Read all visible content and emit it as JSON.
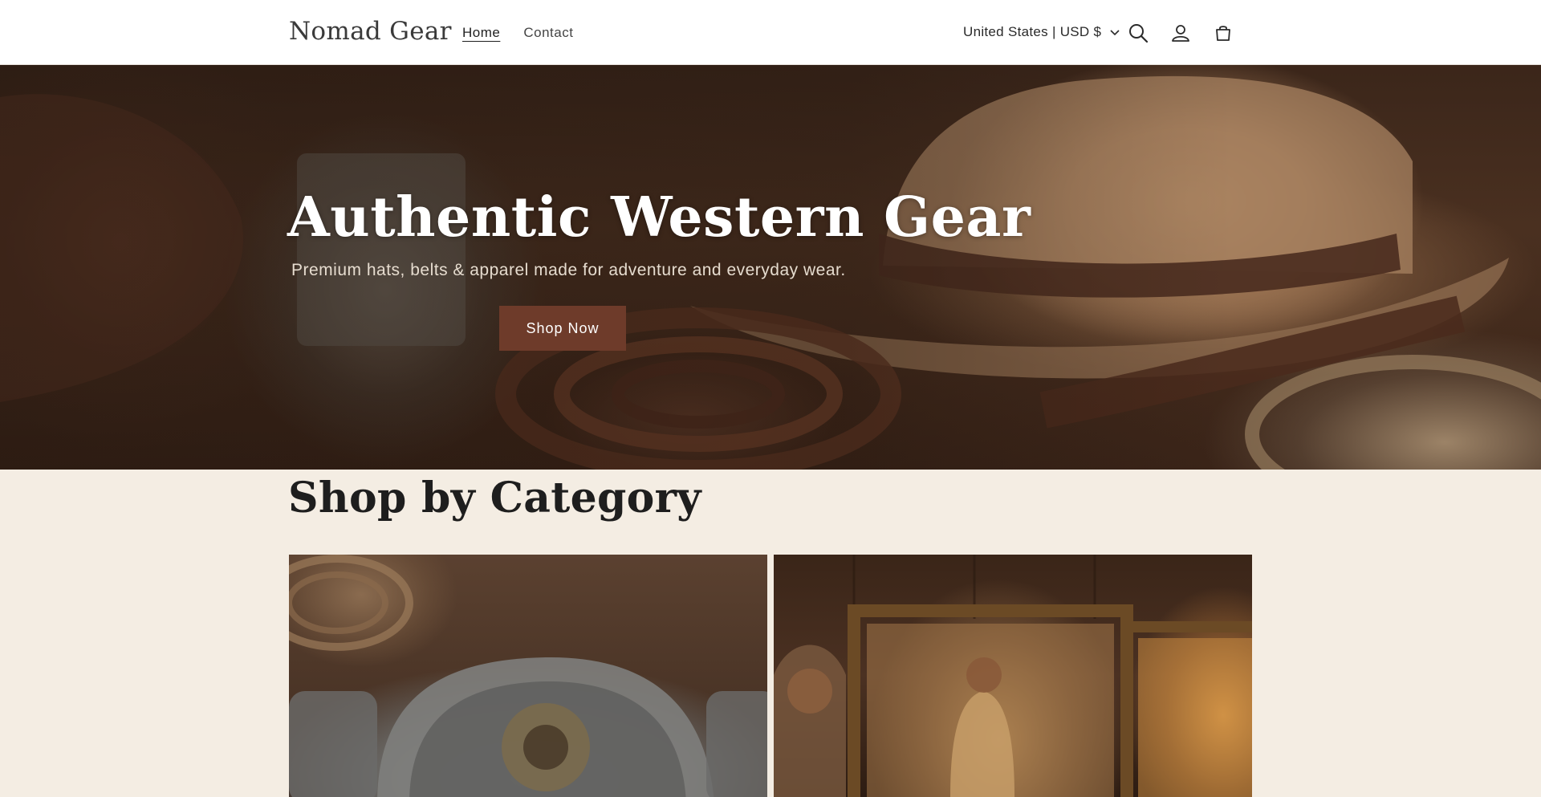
{
  "header": {
    "logo": "Nomad Gear",
    "nav": [
      {
        "label": "Home",
        "active": true
      },
      {
        "label": "Contact",
        "active": false
      }
    ],
    "country_selector": "United States | USD $",
    "icons": [
      "search-icon",
      "account-icon",
      "cart-icon"
    ]
  },
  "hero": {
    "title": "Authentic Western Gear",
    "subtitle": "Premium hats, belts & apparel made for adventure and everyday wear.",
    "cta_label": "Shop Now"
  },
  "categories": {
    "title": "Shop by Category"
  },
  "colors": {
    "accent_button": "#6e3b2a",
    "page_background": "#f4ede3",
    "header_background": "#ffffff"
  }
}
